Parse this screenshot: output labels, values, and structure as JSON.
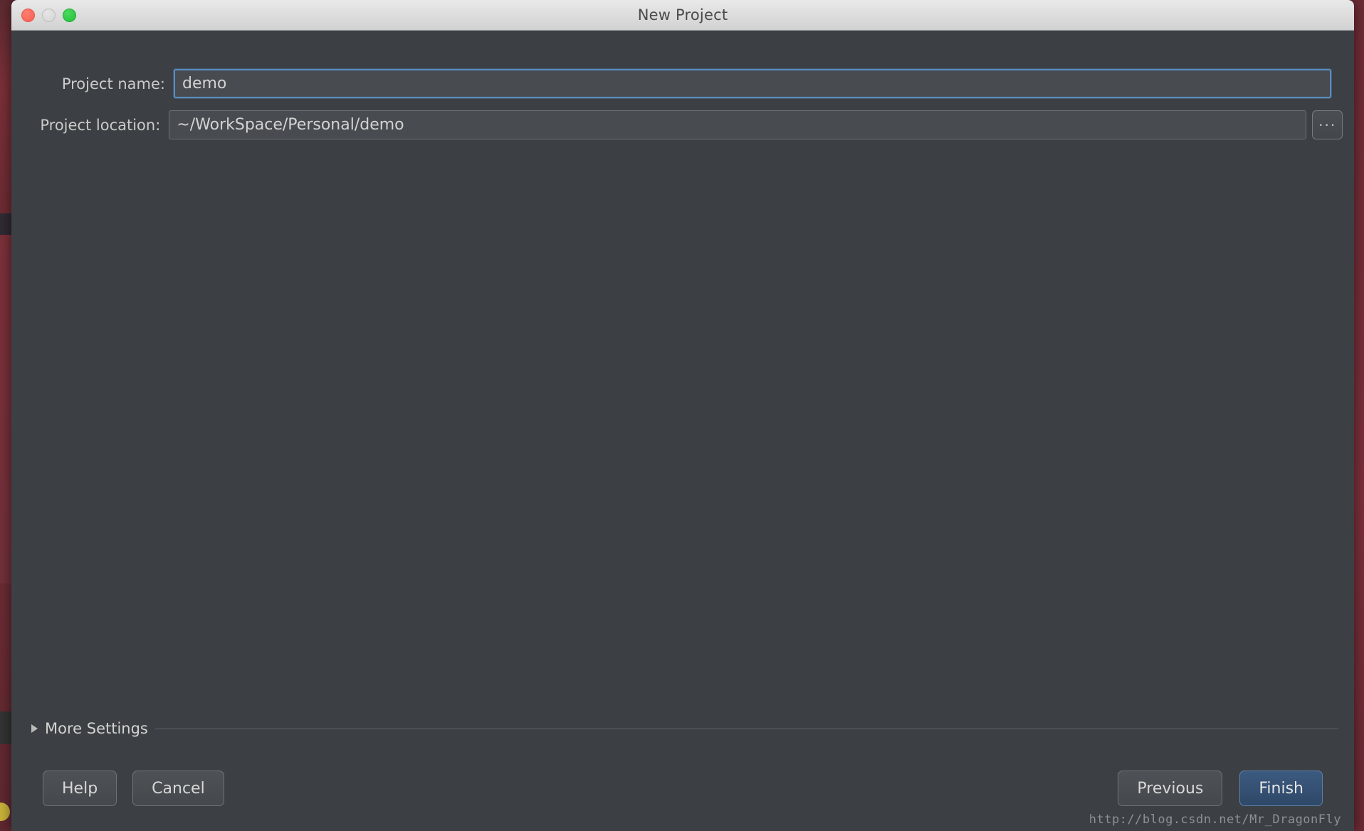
{
  "window": {
    "title": "New Project",
    "traffic_lights": [
      {
        "name": "close-button",
        "color": "#f75c51"
      },
      {
        "name": "minimize-button",
        "color": "#d4d4d4"
      },
      {
        "name": "maximize-button",
        "color": "#22c13a"
      }
    ]
  },
  "form": {
    "project_name": {
      "label": "Project name:",
      "value": "demo",
      "placeholder": "",
      "focused": true
    },
    "project_location": {
      "label": "Project location:",
      "value": "~/WorkSpace/Personal/demo",
      "placeholder": "",
      "focused": false,
      "browse_label": "···"
    }
  },
  "more_settings": {
    "label": "More Settings",
    "expanded": false,
    "disclosure_icon": "triangle-right-icon"
  },
  "buttons": {
    "help": "Help",
    "cancel": "Cancel",
    "previous": "Previous",
    "finish": "Finish"
  },
  "watermark": {
    "text": "http://blog.csdn.net/Mr_DragonFly"
  },
  "colors": {
    "dialog_background": "#3c4044",
    "titlebar_background": "#dcdcdc",
    "input_background": "#484c50",
    "focus_border": "#5a8cc2",
    "primary_button": "#2f4868",
    "text": "#d2d3d2",
    "backdrop": "#6b2b33"
  }
}
